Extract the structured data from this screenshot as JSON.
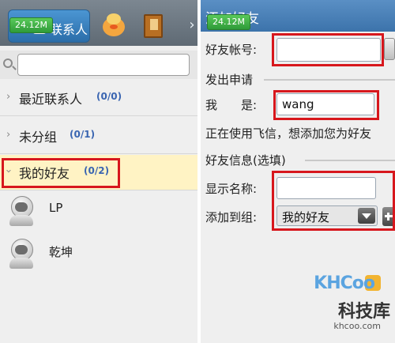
{
  "status": {
    "memory_left": "24.12M",
    "memory_right": "24.12M"
  },
  "left": {
    "tabs": {
      "contacts_label": "联系人"
    },
    "search": {
      "placeholder": ""
    },
    "groups": [
      {
        "name": "最近联系人",
        "count": "(0/0)"
      },
      {
        "name": "未分组",
        "count": "(0/1)"
      },
      {
        "name": "我的好友",
        "count": "(0/2)"
      }
    ],
    "contacts": [
      {
        "name": "LP"
      },
      {
        "name": "乾坤"
      }
    ]
  },
  "right": {
    "title": "添加好友",
    "account_label": "好友帐号:",
    "account_value": "",
    "request_section": "发出申请",
    "me_label": "我　　是:",
    "me_value": "wang",
    "request_text": "正在使用飞信，想添加您为好友",
    "info_section": "好友信息(选填)",
    "display_name_label": "显示名称:",
    "display_name_value": "",
    "add_to_group_label": "添加到组:",
    "group_select_value": "我的好友"
  },
  "watermark": {
    "logo": "KHCoo",
    "name": "科技库",
    "url": "khcoo.com"
  },
  "colors": {
    "highlight_box": "#d7171d",
    "selected_group": "#fff3c4",
    "count_text": "#3a65b1"
  }
}
